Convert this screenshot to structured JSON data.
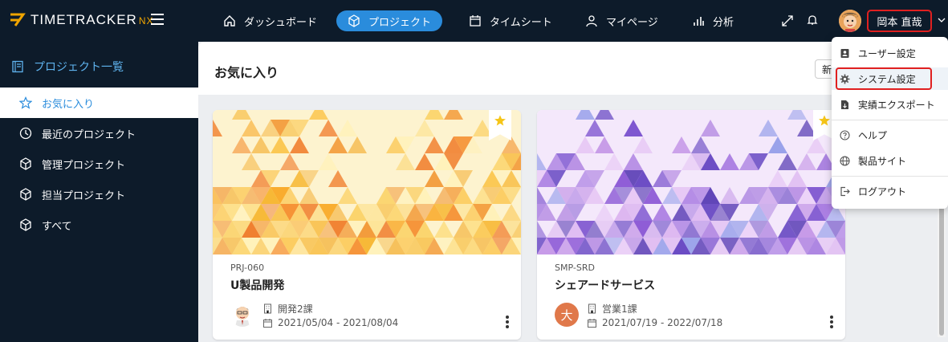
{
  "app": {
    "logo_main": "TIMETRACKER",
    "logo_suffix": "NX"
  },
  "nav": {
    "items": [
      {
        "label": "ダッシュボード",
        "icon": "home-icon"
      },
      {
        "label": "プロジェクト",
        "icon": "cube-icon",
        "active": true
      },
      {
        "label": "タイムシート",
        "icon": "calendar-icon"
      },
      {
        "label": "マイページ",
        "icon": "person-icon"
      },
      {
        "label": "分析",
        "icon": "bar-chart-icon"
      }
    ],
    "user_name": "岡本 直哉"
  },
  "sidebar": {
    "header": "プロジェクト一覧",
    "items": [
      {
        "label": "お気に入り",
        "icon": "star-outline-icon",
        "active": true
      },
      {
        "label": "最近のプロジェクト",
        "icon": "clock-icon"
      },
      {
        "label": "管理プロジェクト",
        "icon": "cube-icon"
      },
      {
        "label": "担当プロジェクト",
        "icon": "cube-icon"
      },
      {
        "label": "すべて",
        "icon": "cube-icon"
      }
    ]
  },
  "main": {
    "title": "お気に入り",
    "new_button_label": "新"
  },
  "cards": [
    {
      "code": "PRJ-060",
      "name": "U製品開発",
      "department": "開発2課",
      "period": "2021/05/04 - 2021/08/04",
      "theme": "orange"
    },
    {
      "code": "SMP-SRD",
      "name": "シェアードサービス",
      "department": "営業1課",
      "period": "2021/07/19 - 2022/07/18",
      "avatar_text": "大",
      "theme": "purple"
    }
  ],
  "dropdown": {
    "items": [
      {
        "label": "ユーザー設定",
        "icon": "user-card-icon"
      },
      {
        "label": "システム設定",
        "icon": "gear-icon",
        "highlighted": true
      },
      {
        "label": "実績エクスポート",
        "icon": "file-export-icon"
      },
      {
        "label": "ヘルプ",
        "icon": "help-circle-icon"
      },
      {
        "label": "製品サイト",
        "icon": "globe-icon"
      },
      {
        "label": "ログアウト",
        "icon": "logout-icon"
      }
    ]
  },
  "colors": {
    "nav_bg": "#0d1b2a",
    "accent": "#2a8cdc",
    "highlight_border": "#e02020",
    "star": "#f5c518"
  }
}
